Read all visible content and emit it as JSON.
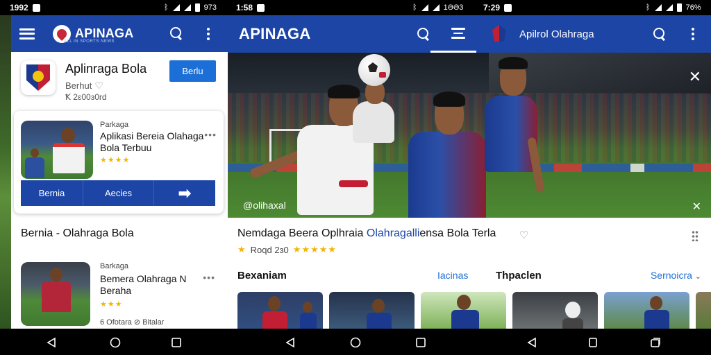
{
  "statusbar": {
    "seg1_time": "1992",
    "seg2_time": "1:58",
    "seg3_time": "7:29",
    "seg1_right": "973",
    "seg2_right": "1ƏƏ3",
    "seg3_right": "76%"
  },
  "left": {
    "brand": "APINAGA",
    "brand_tagline": "ALL IN SPORTS NEWS",
    "app": {
      "name": "Aplinraga Bola",
      "subtitle": "Berhut",
      "count": "Ꝁ 2ɛ00ɜ0rd",
      "install_label": "Berlu"
    },
    "card": {
      "tag": "Parkaga",
      "title": "Aplikasi Bereia Olahaga Bola Terbuu",
      "rating": "★★★★",
      "more": "•••",
      "actions": [
        "Bernia",
        "Aecies",
        "➡"
      ]
    },
    "section_title": "Bernia - Olahraga Bola",
    "item2": {
      "tag": "Barkaga",
      "title": "Bemera Olahraga N Beraha",
      "rating": "★★★",
      "meta": "6 Ofotara  ⊘  Bitalar",
      "more": "•••"
    }
  },
  "right": {
    "brand": "APINAGA",
    "brand2": "Apilrol Olahraga",
    "hero": {
      "caption": "@olihaxal",
      "close": "✕",
      "expand": "✕"
    },
    "title_main": "Nemdaga Beera Oplhraia ",
    "title_highlight": "Olahragalli",
    "title_end": "ensa Bola Terla",
    "rating_text": "Roqd 2ɜ0",
    "rating_stars": "★★★★★",
    "sections": {
      "left": "Bexaniam",
      "middle": "Iacinas",
      "right": "Thpaclen",
      "more": "Sernoicra",
      "more_chevron": "⌄"
    }
  },
  "colors": {
    "appbar": "#1c45a6",
    "accent": "#1c6fd6",
    "star": "#f4b400"
  },
  "icons": [
    "menu-icon",
    "search-icon",
    "more-vert-icon",
    "heart-icon",
    "close-icon",
    "tune-icon",
    "back-icon",
    "home-icon",
    "recents-icon"
  ]
}
